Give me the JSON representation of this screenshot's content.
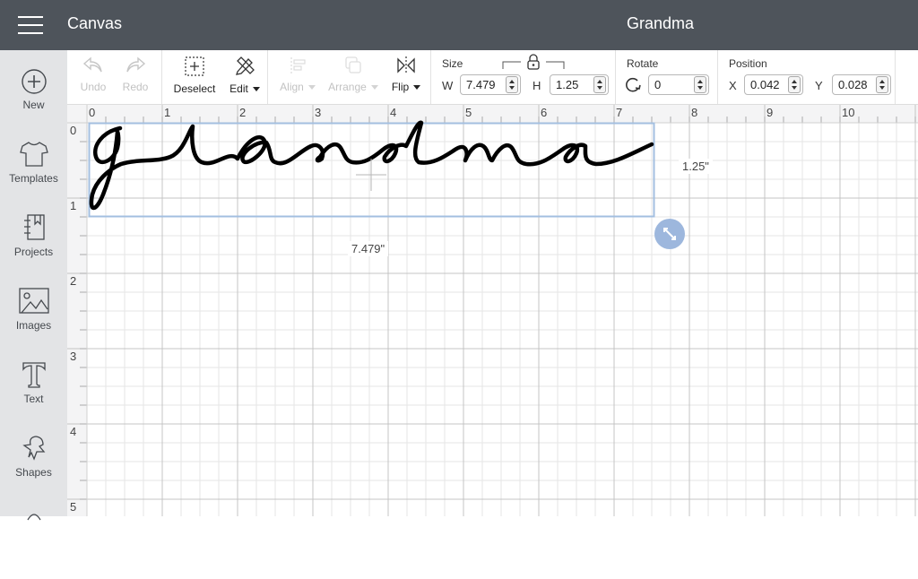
{
  "header": {
    "app_title": "Canvas",
    "document_title": "Grandma"
  },
  "sidebar": {
    "items": [
      {
        "label": "New",
        "icon": "plus-circle-icon"
      },
      {
        "label": "Templates",
        "icon": "tshirt-icon"
      },
      {
        "label": "Projects",
        "icon": "notebook-icon"
      },
      {
        "label": "Images",
        "icon": "image-icon"
      },
      {
        "label": "Text",
        "icon": "text-t-icon"
      },
      {
        "label": "Shapes",
        "icon": "shapes-icon"
      }
    ]
  },
  "toolbar": {
    "undo_label": "Undo",
    "redo_label": "Redo",
    "deselect_label": "Deselect",
    "edit_label": "Edit",
    "align_label": "Align",
    "arrange_label": "Arrange",
    "flip_label": "Flip",
    "size": {
      "title": "Size",
      "w_label": "W",
      "w_value": "7.479",
      "h_label": "H",
      "h_value": "1.25",
      "locked": true
    },
    "rotate": {
      "title": "Rotate",
      "value": "0"
    },
    "position": {
      "title": "Position",
      "x_label": "X",
      "x_value": "0.042",
      "y_label": "Y",
      "y_value": "0.028"
    }
  },
  "canvas": {
    "text_object": "grandma",
    "ruler_x": [
      "0",
      "1",
      "2",
      "3",
      "4",
      "5",
      "6",
      "7",
      "8",
      "9",
      "10"
    ],
    "ruler_y": [
      "0",
      "1",
      "2",
      "3",
      "4",
      "5"
    ],
    "width_readout": "7.479\"",
    "height_readout": "1.25\"",
    "selection_color": "#a3bfe0",
    "handle_color": "#9db7dd"
  }
}
